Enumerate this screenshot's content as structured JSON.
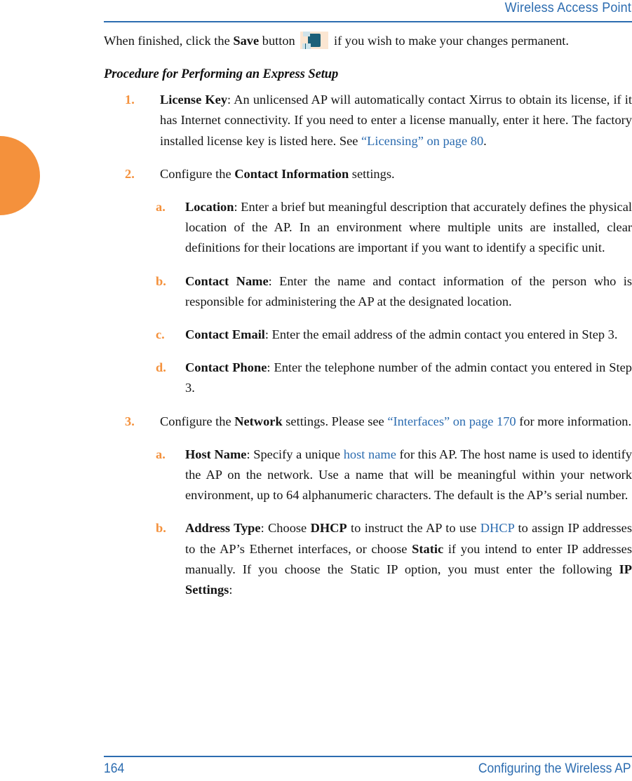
{
  "header": {
    "title": "Wireless Access Point",
    "rule_color": "#2c6cb0"
  },
  "colors": {
    "link": "#2c6cb0",
    "marker": "#f4913c",
    "tab_thumb": "#f4913c",
    "text": "#141414",
    "save_icon_bg": "#fbe6d2",
    "save_icon_fg": "#1d6078"
  },
  "intro": {
    "part1": "When finished, click the ",
    "bold_save": "Save",
    "part2": " button ",
    "icon": "save-icon",
    "part3": " if you wish to make your changes permanent."
  },
  "subhead": "Procedure for Performing an Express Setup",
  "steps": [
    {
      "marker": "1.",
      "bold_lead": "License Key",
      "text_a": ": An unlicensed AP will automatically contact Xirrus to obtain its license, if it has Internet connectivity. If you need to enter a license manually, enter it here. The factory installed license key is listed here. See ",
      "link": "“Licensing” on page 80",
      "text_b": "."
    },
    {
      "marker": "2.",
      "text_pre": "Configure the ",
      "bold_lead": "Contact Information",
      "text_a": " settings.",
      "substeps": [
        {
          "marker": "a.",
          "bold_lead": "Location",
          "text_a": ": Enter a brief but meaningful description that accurately defines the physical location of the AP. In an environment where multiple units are installed, clear definitions for their locations are important if you want to identify a specific unit."
        },
        {
          "marker": "b.",
          "bold_lead": "Contact Name",
          "text_a": ": Enter the name and contact information of the person who is responsible for administering the AP at the designated location."
        },
        {
          "marker": "c.",
          "bold_lead": "Contact Email",
          "text_a": ": Enter the email address of the admin contact you entered in Step 3."
        },
        {
          "marker": "d.",
          "bold_lead": "Contact Phone",
          "text_a": ": Enter the telephone number of the admin contact you entered in Step 3."
        }
      ]
    },
    {
      "marker": "3.",
      "text_pre": "Configure the ",
      "bold_lead": "Network",
      "text_a": " settings. Please see ",
      "link": "“Interfaces” on page 170",
      "text_b": " for more information.",
      "substeps": [
        {
          "marker": "a.",
          "bold_lead": "Host Name",
          "text_a": ": Specify a unique ",
          "link": "host name",
          "text_b": " for this AP. The host name is used to identify the AP on the network. Use a name that will be meaningful within your network environment, up to 64 alphanumeric characters. The default is the AP’s serial number."
        },
        {
          "marker": "b.",
          "bold_lead": "Address Type",
          "text_a": ": Choose ",
          "bold_b": "DHCP",
          "text_b": " to instruct the AP to use ",
          "link": "DHCP",
          "text_c": " to assign IP addresses to the AP’s Ethernet interfaces, or choose ",
          "bold_c": "Static",
          "text_d": " if you intend to enter IP addresses manually. If you choose the Static IP option, you must enter the following ",
          "bold_d": "IP Settings",
          "text_e": ":"
        }
      ]
    }
  ],
  "footer": {
    "page_number": "164",
    "chapter": "Configuring the Wireless AP"
  }
}
